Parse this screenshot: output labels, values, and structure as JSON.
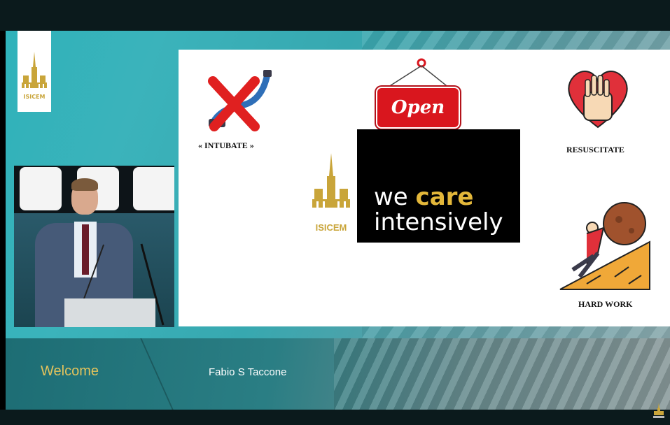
{
  "lower_third": {
    "welcome": "Welcome",
    "speaker": "Fabio S Taccone"
  },
  "branding": {
    "logo_text": "ISICEM",
    "accent_gold": "#e3b73a",
    "teal": "#2fb2ba"
  },
  "slide": {
    "open_sign": "Open",
    "tagline_part1": "we ",
    "tagline_accent": "care",
    "tagline_part2": "intensively",
    "logo_text": "ISICEM",
    "caption_intubate": "« INTUBATE »",
    "caption_resuscitate": "RESUSCITATE",
    "caption_hard_work": "HARD WORK"
  },
  "icons": {
    "intubate": "crossed-intubation-icon",
    "resuscitate": "heart-hands-icon",
    "hard_work": "sisyphus-boulder-icon",
    "logo": "cathedral-logo-icon"
  }
}
